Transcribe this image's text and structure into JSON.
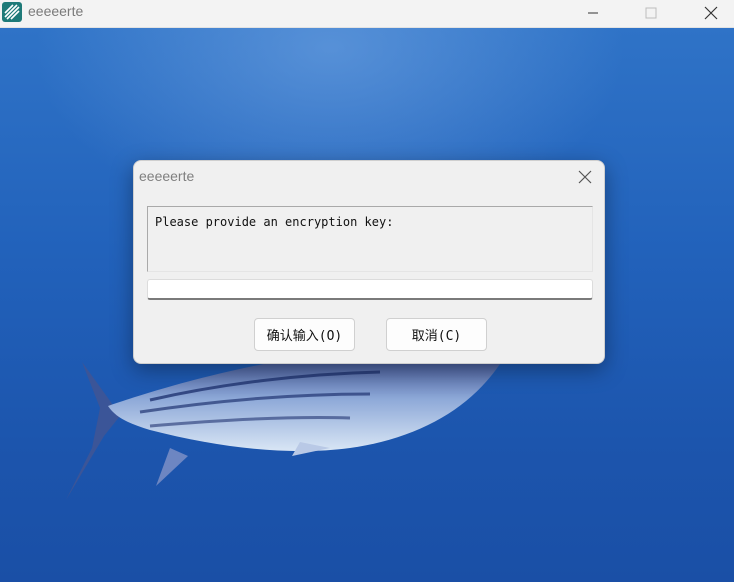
{
  "window": {
    "title": "eeeeerte",
    "icon": "app-logo-icon",
    "controls": [
      "minimize-icon",
      "maximize-icon",
      "close-icon"
    ]
  },
  "dialog": {
    "title": "eeeeerte",
    "prompt": "Please provide an encryption key:",
    "input_value": "",
    "ok_label": "确认输入(O)",
    "cancel_label": "取消(C)"
  },
  "colors": {
    "titlebar": "#f3f3f3",
    "dialog_bg": "#f0f0f0",
    "desktop_blue": "#2262bb",
    "icon_teal": "#1e7a78"
  }
}
